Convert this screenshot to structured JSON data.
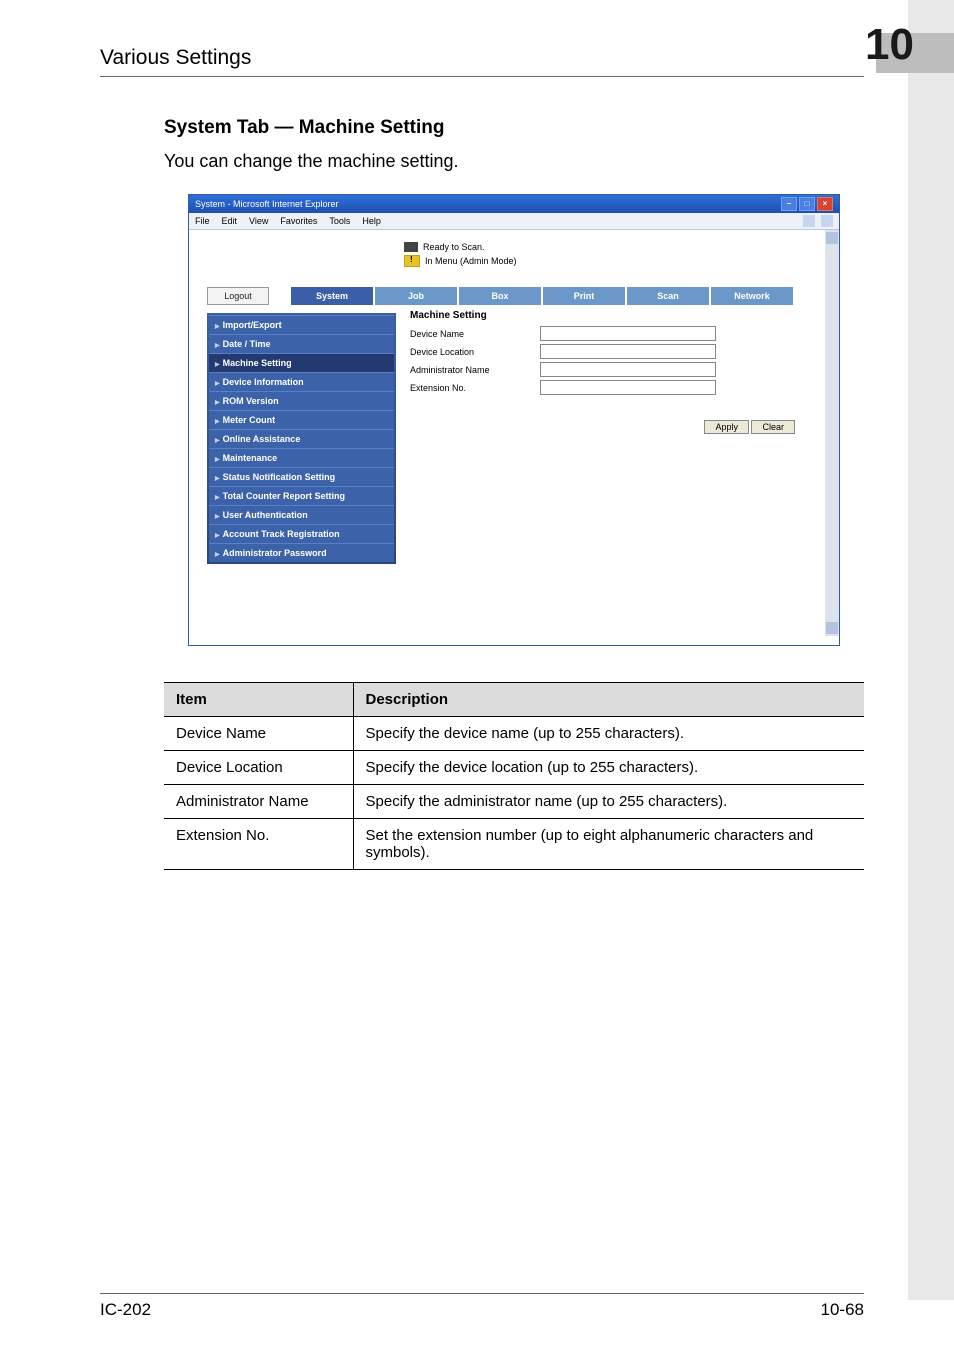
{
  "header": {
    "title": "Various Settings",
    "chapter_number": "10"
  },
  "section": {
    "heading": "System Tab — Machine Setting",
    "lead": "You can change the machine setting."
  },
  "ie": {
    "title": "System - Microsoft Internet Explorer",
    "menu": {
      "file": "File",
      "edit": "Edit",
      "view": "View",
      "favorites": "Favorites",
      "tools": "Tools",
      "help": "Help"
    },
    "status": {
      "ready": "Ready to Scan.",
      "admin": "In Menu (Admin Mode)"
    },
    "tabs": {
      "logout": "Logout",
      "system": "System",
      "job": "Job",
      "box": "Box",
      "print": "Print",
      "scan": "Scan",
      "network": "Network"
    },
    "sidebar": [
      "Import/Export",
      "Date / Time",
      "Machine Setting",
      "Device Information",
      "ROM Version",
      "Meter Count",
      "Online Assistance",
      "Maintenance",
      "Status Notification Setting",
      "Total Counter Report Setting",
      "User Authentication",
      "Account Track Registration",
      "Administrator Password"
    ],
    "form": {
      "title": "Machine Setting",
      "rows": {
        "device_name": "Device Name",
        "device_location": "Device Location",
        "admin_name": "Administrator Name",
        "ext_no": "Extension No."
      },
      "apply": "Apply",
      "clear": "Clear"
    }
  },
  "table": {
    "headers": {
      "item": "Item",
      "desc": "Description"
    },
    "rows": [
      {
        "item": "Device Name",
        "desc": "Specify the device name (up to 255 characters)."
      },
      {
        "item": "Device Location",
        "desc": "Specify the device location (up to 255 characters)."
      },
      {
        "item": "Administrator Name",
        "desc": "Specify the administrator name (up to 255 characters)."
      },
      {
        "item": "Extension No.",
        "desc": "Set the extension number (up to eight alphanumeric characters and symbols)."
      }
    ]
  },
  "footer": {
    "left": "IC-202",
    "right": "10-68"
  }
}
